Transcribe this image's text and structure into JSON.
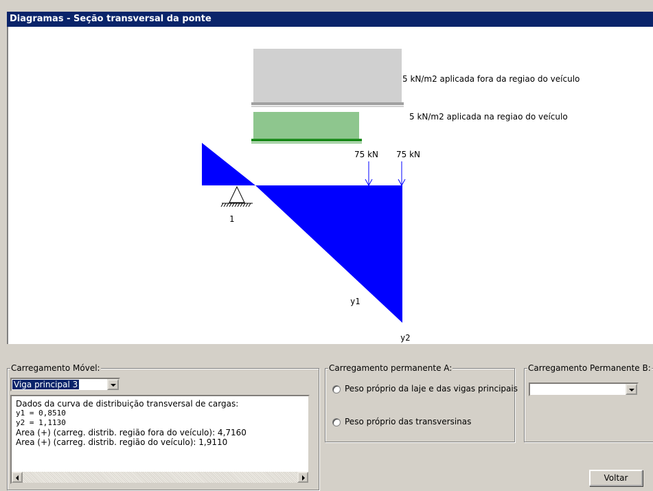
{
  "window": {
    "title": "Diagramas - Seção transversal da ponte"
  },
  "diagram": {
    "load_outside_label": "5 kN/m2 aplicada fora da regiao do veículo",
    "load_inside_label": "5 kN/m2 aplicada na regiao do veículo",
    "point_load_1": "75 kN",
    "point_load_2": "75 kN",
    "support_label": "1",
    "y1_label": "y1",
    "y2_label": "y2",
    "colors": {
      "diagram_fill": "#0000ff",
      "outside_load": "#a0a0a0",
      "inside_load": "#1e8c1e"
    }
  },
  "moving_load": {
    "title": "Carregamento Móvel:",
    "selected": "Viga principal 3",
    "info_lines": [
      "Dados da curva de distribuição transversal de cargas:",
      "y1 = 0,8510",
      "y2 = 1,1130",
      "Area (+) (carreg. distrib. região fora do veículo): 4,7160",
      "Area (+) (carreg. distrib. região do veículo): 1,9110"
    ]
  },
  "permanent_a": {
    "title": "Carregamento permanente A:",
    "option1": "Peso próprio da laje e das vigas principais",
    "option2": "Peso próprio das transversinas"
  },
  "permanent_b": {
    "title": "Carregamento Permanente B:",
    "selected": ""
  },
  "buttons": {
    "back": "Voltar"
  }
}
